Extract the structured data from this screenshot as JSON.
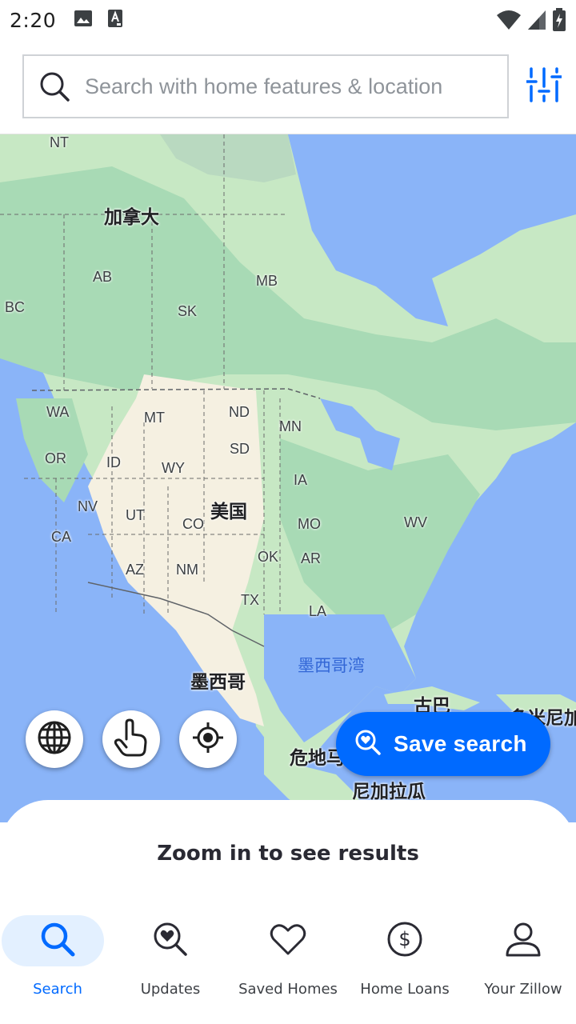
{
  "status_bar": {
    "time": "2:20",
    "icons": [
      "image-icon",
      "text-a-icon",
      "wifi-icon",
      "signal-icon",
      "battery-charging-icon"
    ]
  },
  "search": {
    "placeholder": "Search with home features & location",
    "value": ""
  },
  "map": {
    "labels": {
      "nt": "NT",
      "canada": "加拿大",
      "ab": "AB",
      "mb": "MB",
      "bc": "BC",
      "sk": "SK",
      "wa": "WA",
      "mt": "MT",
      "nd": "ND",
      "mn": "MN",
      "or": "OR",
      "id": "ID",
      "wy": "WY",
      "sd": "SD",
      "ia": "IA",
      "nv": "NV",
      "ut": "UT",
      "usa": "美国",
      "co": "CO",
      "mo": "MO",
      "wv": "WV",
      "ca": "CA",
      "ok": "OK",
      "ar": "AR",
      "az": "AZ",
      "nm": "NM",
      "tx": "TX",
      "la": "LA",
      "gulf": "墨西哥湾",
      "mexico": "墨西哥",
      "cuba": "古巴",
      "dominican": "多米尼加",
      "guatemala": "危地马拉",
      "nicaragua": "尼加拉瓜"
    },
    "colors": {
      "water": "#8ab4f8",
      "forest": "#a8dab5",
      "desert": "#f5f0e1",
      "land": "#c7e8c4"
    }
  },
  "map_buttons": {
    "globe": "globe-icon",
    "draw": "hand-pointer-icon",
    "locate": "location-target-icon"
  },
  "save_search": {
    "label": "Save search"
  },
  "results_message": "Zoom in to see results",
  "nav": {
    "items": [
      {
        "label": "Search",
        "icon": "search-icon",
        "active": true
      },
      {
        "label": "Updates",
        "icon": "heart-search-icon",
        "active": false
      },
      {
        "label": "Saved Homes",
        "icon": "heart-icon",
        "active": false
      },
      {
        "label": "Home Loans",
        "icon": "dollar-icon",
        "active": false
      },
      {
        "label": "Your Zillow",
        "icon": "person-icon",
        "active": false
      }
    ],
    "accent_color": "#006aff"
  }
}
